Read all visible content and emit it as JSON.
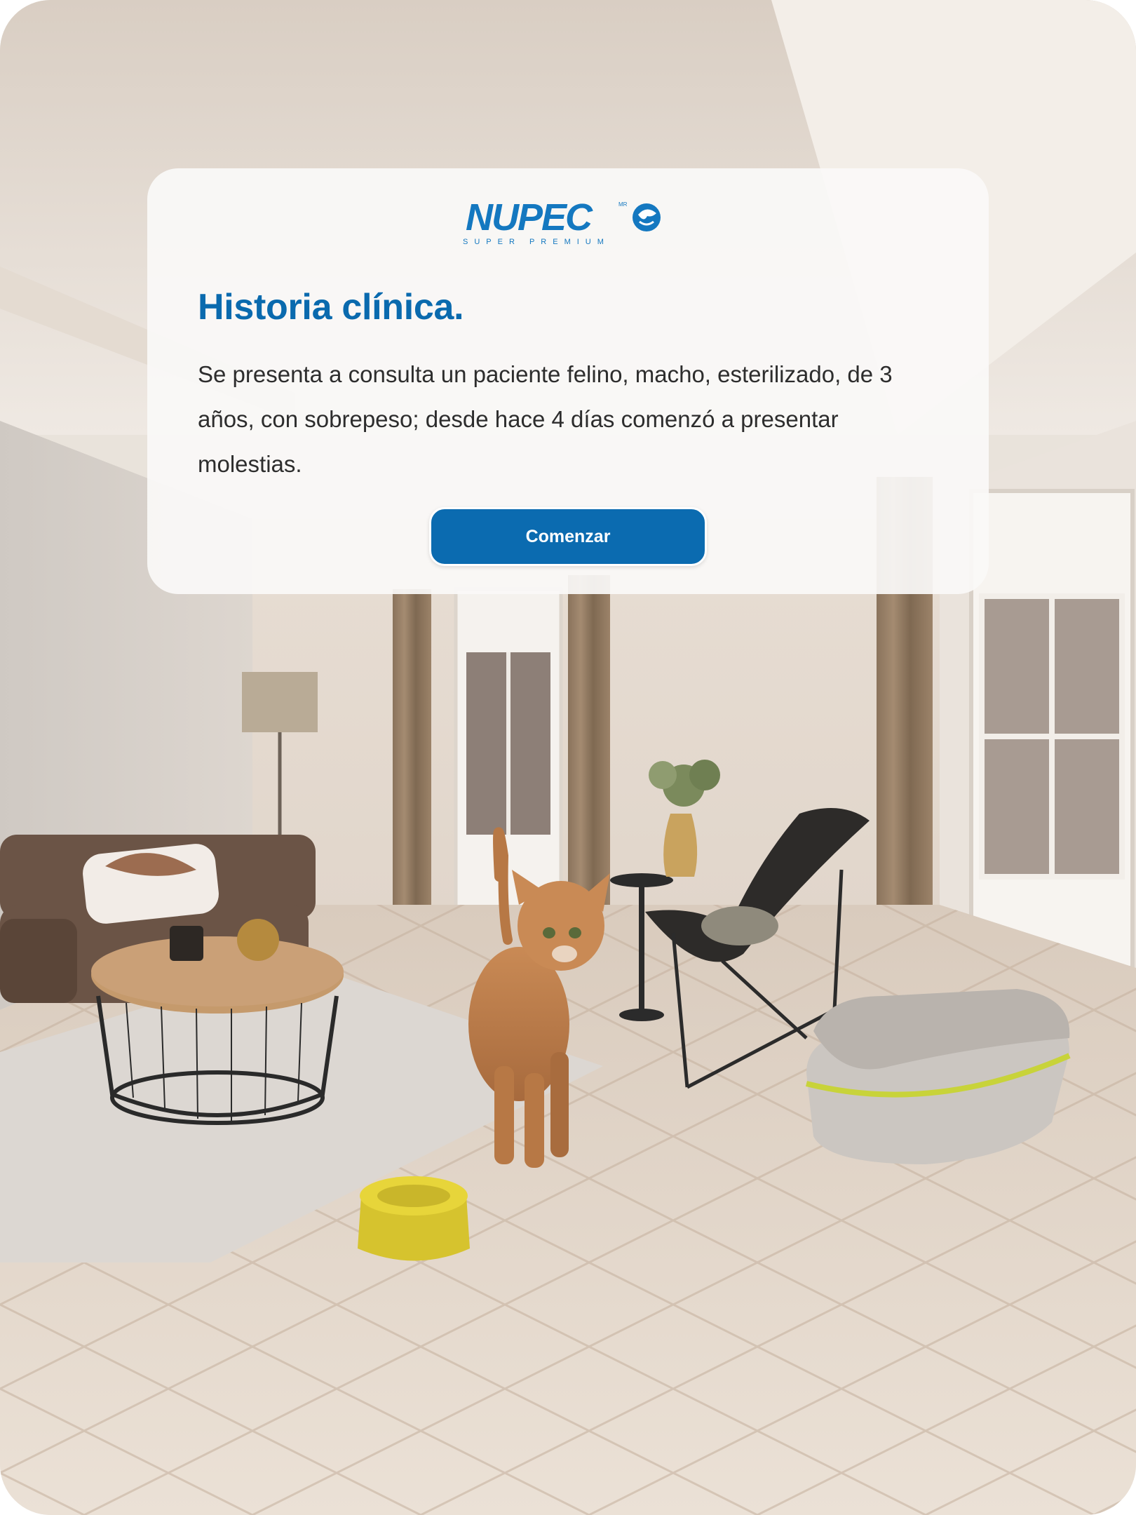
{
  "brand": {
    "name": "NUPEC",
    "mark": "MR",
    "tagline": "SUPER PREMIUM",
    "color": "#1478c0"
  },
  "card": {
    "title": "Historia clínica.",
    "text": "Se presenta a consulta un paciente felino, macho, esterilizado, de 3 años, con sobrepeso; desde hace 4 días comenzó a presentar molestias.",
    "button_label": "Comenzar"
  },
  "colors": {
    "title": "#0a6aae",
    "button": "#0b6bb0",
    "body_text": "#2d2d2d"
  },
  "scene": {
    "objects": [
      "sofa-icon",
      "coffee-table-icon",
      "floor-lamp-icon",
      "cat-icon",
      "food-bowl-icon",
      "litter-box-icon",
      "butterfly-chair-icon",
      "plant-vase-icon"
    ]
  }
}
